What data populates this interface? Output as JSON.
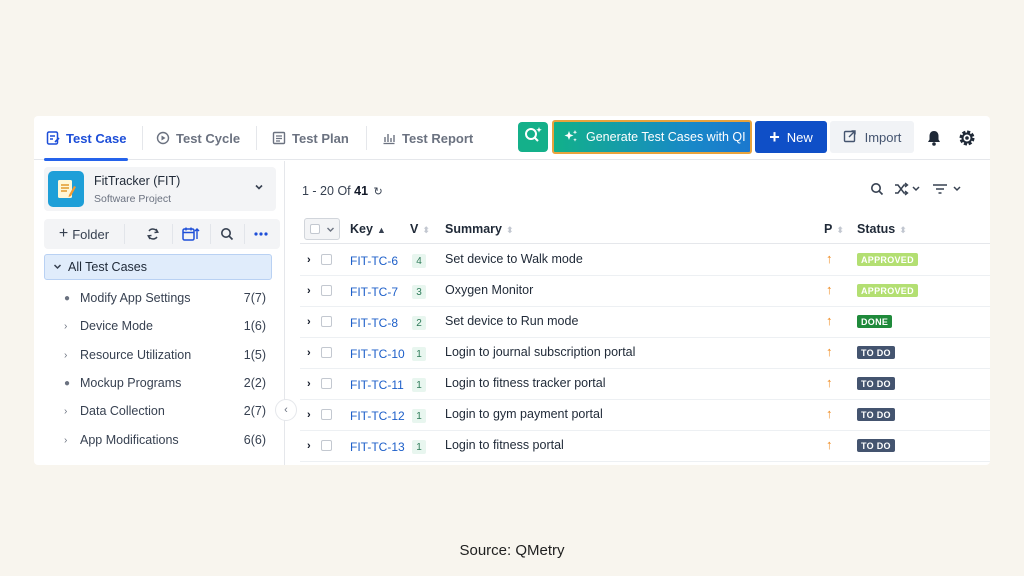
{
  "tabs": [
    {
      "label": "Test Case",
      "active": true,
      "icon": "test-case-icon"
    },
    {
      "label": "Test Cycle",
      "active": false,
      "icon": "cycle-icon"
    },
    {
      "label": "Test Plan",
      "active": false,
      "icon": "plan-icon"
    },
    {
      "label": "Test Report",
      "active": false,
      "icon": "report-icon"
    }
  ],
  "toolbar": {
    "generate_label": "Generate Test Cases with QI",
    "new_label": "New",
    "import_label": "Import"
  },
  "project": {
    "name": "FitTracker (FIT)",
    "type": "Software Project"
  },
  "left_tools": {
    "folder_label": "Folder"
  },
  "tree": {
    "root_label": "All Test Cases",
    "folders": [
      {
        "name": "Modify App Settings",
        "count": "7(7)",
        "expandable": false
      },
      {
        "name": "Device Mode",
        "count": "1(6)",
        "expandable": true
      },
      {
        "name": "Resource Utilization",
        "count": "1(5)",
        "expandable": true
      },
      {
        "name": "Mockup Programs",
        "count": "2(2)",
        "expandable": false
      },
      {
        "name": "Data Collection",
        "count": "2(7)",
        "expandable": true
      },
      {
        "name": "App Modifications",
        "count": "6(6)",
        "expandable": true
      }
    ]
  },
  "pager": {
    "range": "1 - 20",
    "of_label": "Of",
    "total": "41"
  },
  "columns": {
    "key": "Key",
    "version": "V",
    "summary": "Summary",
    "priority": "P",
    "status": "Status"
  },
  "rows": [
    {
      "key": "FIT-TC-6",
      "version": "4",
      "summary": "Set device to Walk mode",
      "status": "APPROVED"
    },
    {
      "key": "FIT-TC-7",
      "version": "3",
      "summary": "Oxygen Monitor",
      "status": "APPROVED"
    },
    {
      "key": "FIT-TC-8",
      "version": "2",
      "summary": "Set device to Run mode",
      "status": "DONE"
    },
    {
      "key": "FIT-TC-10",
      "version": "1",
      "summary": "Login to journal subscription portal",
      "status": "TO DO"
    },
    {
      "key": "FIT-TC-11",
      "version": "1",
      "summary": "Login to fitness tracker portal",
      "status": "TO DO"
    },
    {
      "key": "FIT-TC-12",
      "version": "1",
      "summary": "Login to gym payment portal",
      "status": "TO DO"
    },
    {
      "key": "FIT-TC-13",
      "version": "1",
      "summary": "Login to fitness portal",
      "status": "TO DO"
    }
  ],
  "status_colors": {
    "APPROVED": "#b3df72",
    "DONE": "#1f8a3b",
    "TO DO": "#44546f"
  },
  "colors": {
    "accent": "#2563eb",
    "qi_green": "#14b08a",
    "priority_orange": "#ef8a21"
  },
  "caption": "Source: QMetry"
}
